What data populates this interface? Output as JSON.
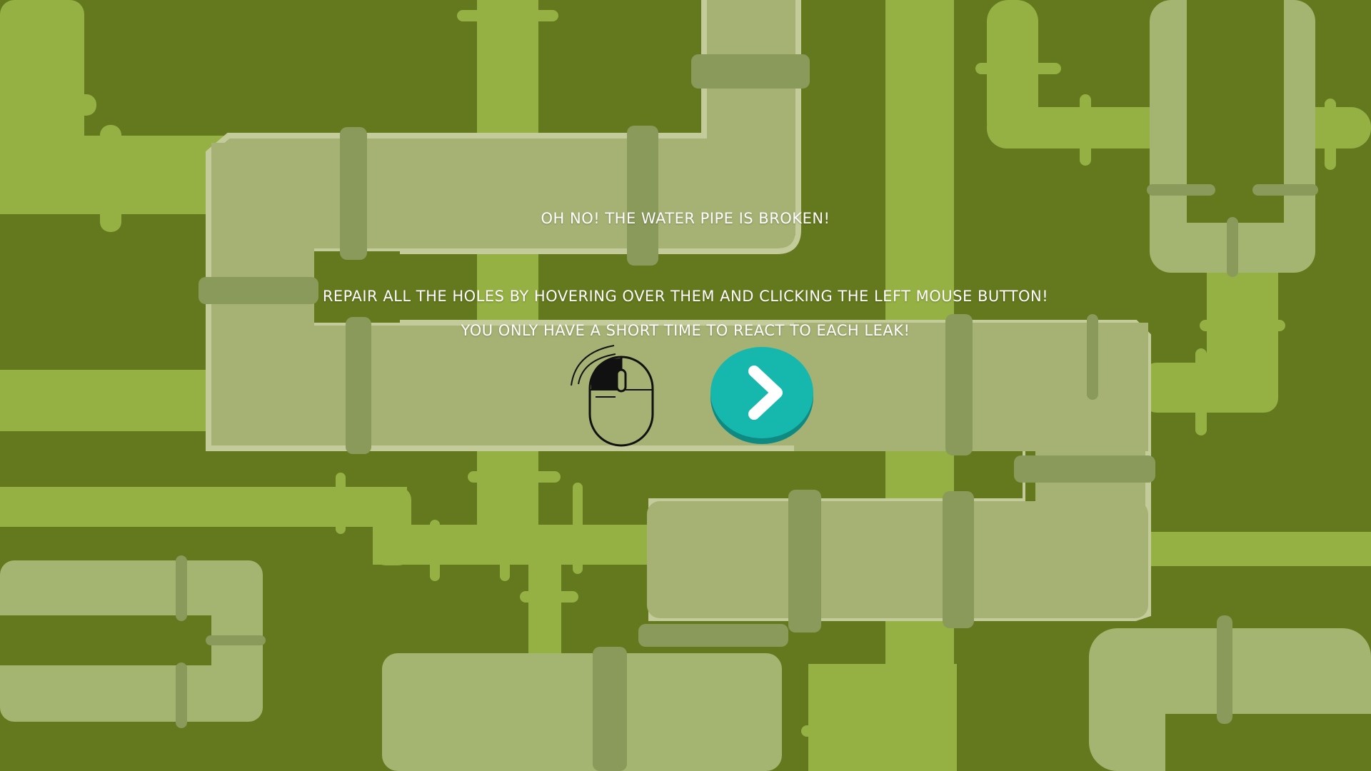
{
  "dialog": {
    "title": "OH NO! THE WATER PIPE IS BROKEN!",
    "instruction_1": "REPAIR ALL THE HOLES BY HOVERING OVER THEM AND CLICKING THE LEFT MOUSE BUTTON!",
    "instruction_2": "YOU ONLY HAVE A SHORT TIME TO REACT TO EACH LEAK!"
  },
  "icons": {
    "mouse": "left-mouse-click-icon",
    "next": "chevron-right-icon"
  },
  "colors": {
    "background": "#64791d",
    "pipe_bright": "#95b043",
    "pipe_light": "#a1bb4c",
    "pipe_pale": "#a5b273",
    "pipe_clamp": "#8a9a5a",
    "pipe_outline": "#c3cb9a",
    "next_button": "#16b8ad",
    "next_button_shadow": "#0f8a83",
    "text": "#ffffff"
  }
}
